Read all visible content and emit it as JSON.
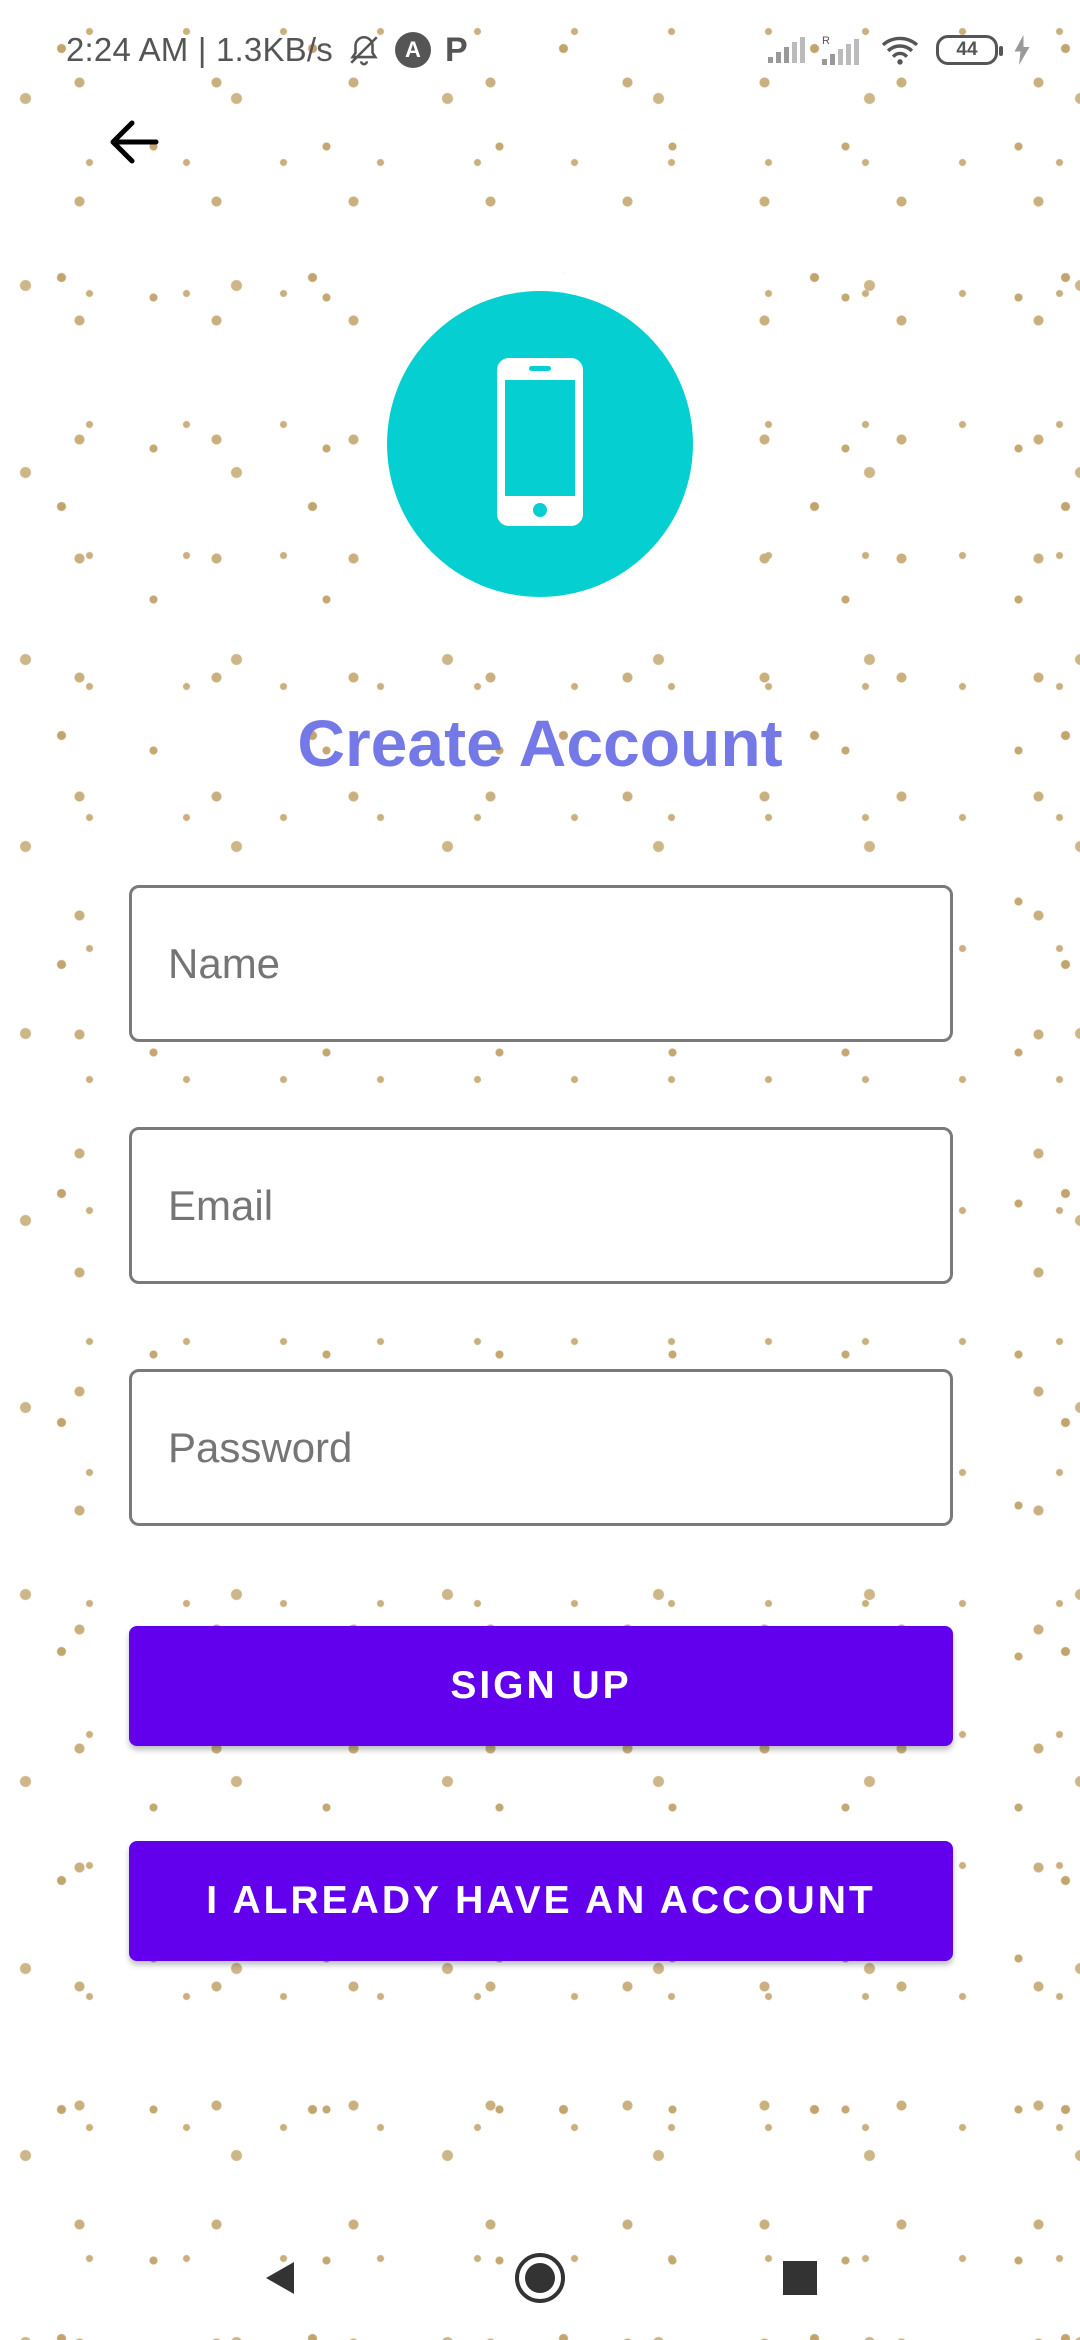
{
  "status_bar": {
    "time_speed": "2:24 AM | 1.3KB/s",
    "notification_icons": [
      "bell-muted-icon",
      "a-circle-icon",
      "p-icon"
    ],
    "p_label": "P",
    "a_label": "A",
    "battery_level": "44",
    "indicator_icons": [
      "signal-icon",
      "signal-roaming-icon",
      "wifi-icon",
      "battery-icon",
      "charging-icon"
    ]
  },
  "header": {
    "back_icon": "arrow-left-icon"
  },
  "logo": {
    "icon": "smartphone-icon",
    "color": "#06cfd1"
  },
  "main": {
    "title": "Create Account",
    "title_color": "#7579e7",
    "fields": {
      "name_placeholder": "Name",
      "email_placeholder": "Email",
      "password_placeholder": "Password"
    },
    "buttons": {
      "sign_up": "SIGN UP",
      "have_account": "I ALREADY HAVE AN ACCOUNT"
    },
    "button_color": "#6200ee"
  },
  "nav_bar": {
    "icons": [
      "back-triangle-icon",
      "home-circle-icon",
      "recents-square-icon"
    ]
  }
}
